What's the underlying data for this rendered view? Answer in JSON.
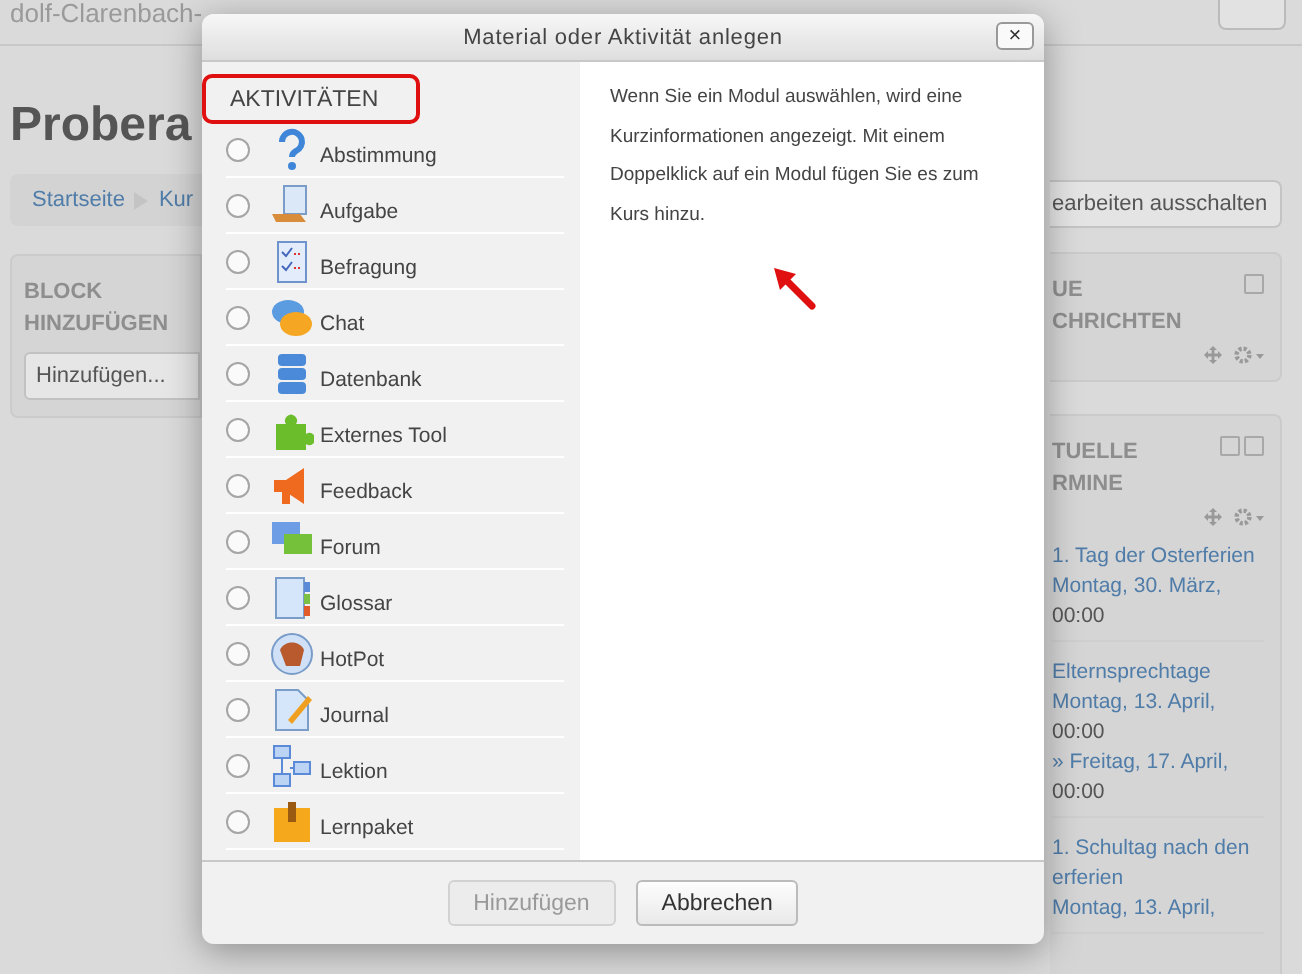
{
  "page": {
    "header_text": "dolf-Clarenbach-",
    "course_title": "Probera",
    "breadcrumb": [
      "Startseite",
      "Kur"
    ],
    "add_block": {
      "title_lines": [
        "BLOCK",
        "HINZUFÜGEN"
      ],
      "select_value": "Hinzufügen..."
    },
    "edit_button": "earbeiten ausschalten",
    "news_block": {
      "title_lines": [
        "UE",
        "CHRICHTEN"
      ]
    },
    "events_block": {
      "title_lines": [
        "TUELLE",
        "RMINE"
      ],
      "events": [
        {
          "lines": [
            "1. Tag der Osterferien",
            "Montag, 30. März,"
          ],
          "time": "00:00"
        },
        {
          "lines": [
            "Elternsprechtage",
            "Montag, 13. April,"
          ],
          "time": "00:00",
          "end_lines": [
            "» Freitag, 17. April,"
          ],
          "end_time": "00:00"
        },
        {
          "lines": [
            "1. Schultag nach den",
            "erferien",
            "Montag, 13. April,"
          ]
        }
      ]
    }
  },
  "dialog": {
    "title": "Material oder Aktivität anlegen",
    "close": "×",
    "section": "AKTIVITÄTEN",
    "modules": [
      {
        "label": "Abstimmung",
        "selected": false
      },
      {
        "label": "Aufgabe",
        "selected": false
      },
      {
        "label": "Befragung",
        "selected": false
      },
      {
        "label": "Chat",
        "selected": false
      },
      {
        "label": "Datenbank",
        "selected": false
      },
      {
        "label": "Externes Tool",
        "selected": false
      },
      {
        "label": "Feedback",
        "selected": false
      },
      {
        "label": "Forum",
        "selected": false
      },
      {
        "label": "Glossar",
        "selected": false
      },
      {
        "label": "HotPot",
        "selected": false
      },
      {
        "label": "Journal",
        "selected": false
      },
      {
        "label": "Lektion",
        "selected": false
      },
      {
        "label": "Lernpaket",
        "selected": false
      }
    ],
    "help_text": "Wenn Sie ein Modul auswählen, wird eine Kurzinformationen angezeigt. Mit einem Doppelklick auf ein Modul fügen Sie es zum Kurs hinzu.",
    "buttons": [
      {
        "label": "Hinzufügen",
        "disabled": true
      },
      {
        "label": "Abbrechen",
        "disabled": false
      }
    ]
  }
}
